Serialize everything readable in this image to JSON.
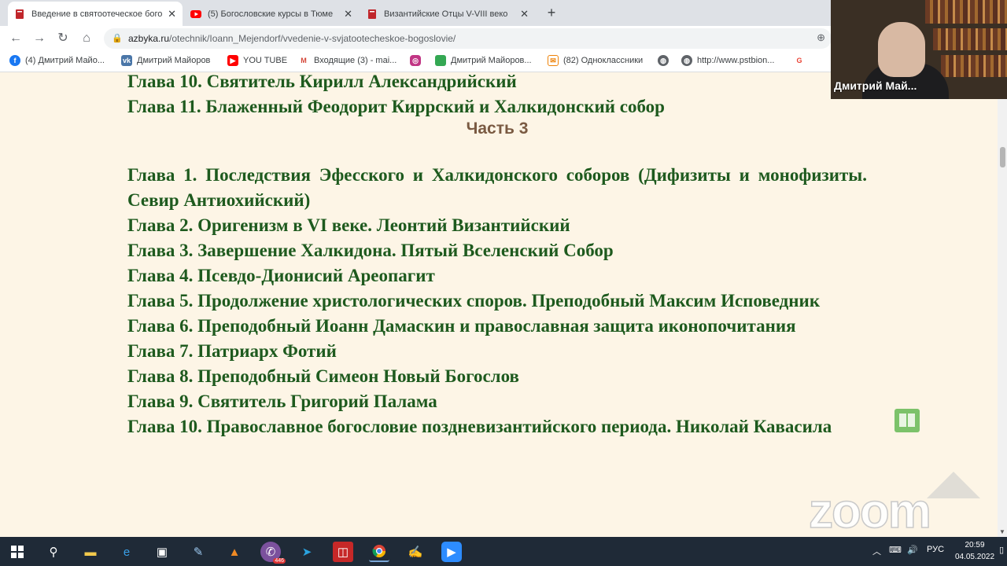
{
  "browser": {
    "tabs": [
      {
        "title": "Введение в святоотеческое бого",
        "active": true,
        "icon": "red-book-icon"
      },
      {
        "title": "(5) Богословские курсы в Тюме",
        "active": false,
        "icon": "youtube-icon"
      },
      {
        "title": "Византийские Отцы V-VIII веко",
        "active": false,
        "icon": "red-book-icon"
      }
    ],
    "url_domain": "azbyka.ru",
    "url_path": "/otechnik/Ioann_Mejendorf/vvedenie-v-svjatootecheskoe-bogoslovie/",
    "bookmarks": [
      {
        "label": "(4) Дмитрий Майо...",
        "icon": "facebook-icon",
        "color": "#1877f2"
      },
      {
        "label": "Дмитрий Майоров",
        "icon": "vk-icon",
        "color": "#4a76a8"
      },
      {
        "label": "YOU TUBE",
        "icon": "youtube-icon",
        "color": "#ff0000"
      },
      {
        "label": "Входящие (3) - mai...",
        "icon": "gmail-icon",
        "color": "#d44638"
      },
      {
        "label": "",
        "icon": "instagram-icon",
        "color": "#c13584"
      },
      {
        "label": "Дмитрий Майоров...",
        "icon": "green-square-icon",
        "color": "#34a853"
      },
      {
        "label": "(82) Одноклассники",
        "icon": "odnoklassniki-icon",
        "color": "#ee8208"
      },
      {
        "label": "",
        "icon": "globe-icon",
        "color": "#5f6368"
      },
      {
        "label": "http://www.pstbion...",
        "icon": "globe-icon",
        "color": "#5f6368"
      },
      {
        "label": "",
        "icon": "google-icon",
        "color": "#ea4335"
      }
    ]
  },
  "content": {
    "top_lines": [
      "Глава 10. Святитель Кирилл Александрийский",
      "Глава 11. Блаженный Феодорит Киррский и Халкидонский собор"
    ],
    "part_heading": "Часть 3",
    "chapters": [
      "Глава 1. Последствия Эфесского и Халкидонского соборов (Дифизиты и монофизиты. Севир Антиохийский)",
      "Глава 2. Оригенизм в VI веке. Леонтий Византийский",
      "Глава 3. Завершение Халкидона. Пятый Вселенский Собор",
      "Глава 4. Псевдо-Дионисий Ареопагит",
      "Глава 5. Продолжение христологических споров. Преподобный Максим Исповедник",
      "Глава 6. Преподобный Иоанн Дамаскин и православная защита иконопочитания",
      "Глава 7. Патриарх Фотий",
      "Глава 8. Преподобный Симеон Новый Богослов",
      "Глава 9. Святитель Григорий Палама",
      "Глава 10. Православное богословие поздневизантийского периода. Николай Кавасила"
    ],
    "text_color": "#1e5a1e",
    "heading_color": "#7a5a42",
    "background_color": "#fdf5e6"
  },
  "video": {
    "participant_name": "Дмитрий Май..."
  },
  "overlay": {
    "watermark": "zoom"
  },
  "taskbar": {
    "language": "РУС",
    "time": "20:59",
    "date": "04.05.2022",
    "badge_count": "446",
    "apps": [
      "windows-start-icon",
      "search-icon",
      "file-explorer-icon",
      "edge-icon",
      "store-icon",
      "paint-icon",
      "vlc-icon",
      "viber-icon",
      "telegram-icon",
      "antivirus-icon",
      "chrome-icon",
      "notepad-icon",
      "zoom-icon"
    ]
  }
}
